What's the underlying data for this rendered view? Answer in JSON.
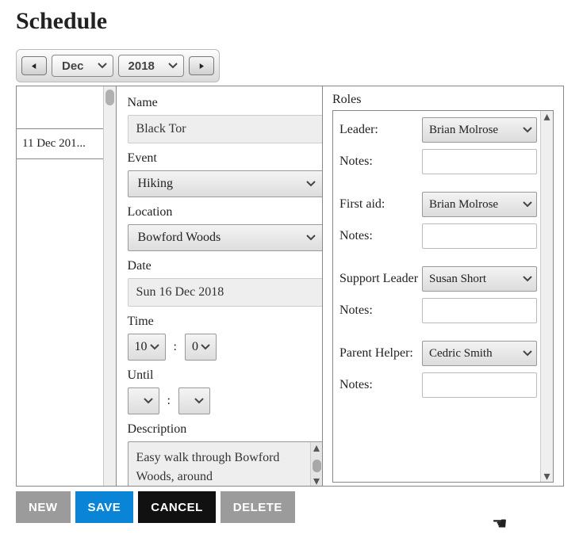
{
  "page_title": "Schedule",
  "datepicker": {
    "month": "Dec",
    "year": "2018"
  },
  "left_list": {
    "row1": "11 Dec 201..."
  },
  "form": {
    "name_label": "Name",
    "name_value": "Black Tor",
    "event_label": "Event",
    "event_value": "Hiking",
    "location_label": "Location",
    "location_value": "Bowford Woods",
    "date_label": "Date",
    "date_value": "Sun 16 Dec 2018",
    "time_label": "Time",
    "time_hour": "10",
    "time_min": "0",
    "until_label": "Until",
    "until_hour": "",
    "until_min": "",
    "desc_label": "Description",
    "desc_value": "Easy walk through Bowford Woods, around"
  },
  "roles": {
    "title": "Roles",
    "leader_label": "Leader:",
    "leader_value": "Brian Molrose",
    "firstaid_label": "First aid:",
    "firstaid_value": "Brian Molrose",
    "support_label": "Support Leader:",
    "support_value": "Susan Short",
    "parent_label": "Parent Helper:",
    "parent_value": "Cedric Smith",
    "notes_label": "Notes:"
  },
  "buttons": {
    "new": "NEW",
    "save": "SAVE",
    "cancel": "CANCEL",
    "delete": "DELETE"
  },
  "colon": ":"
}
